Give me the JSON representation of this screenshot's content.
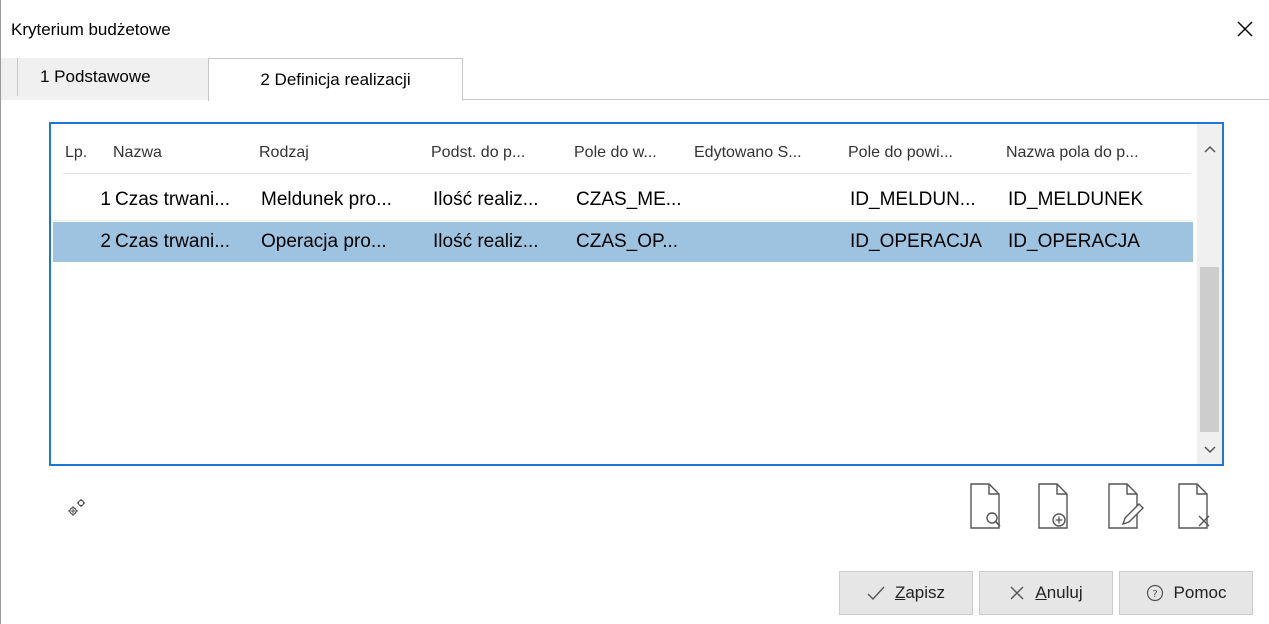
{
  "window": {
    "title": "Kryterium budżetowe"
  },
  "tabs": [
    {
      "label": "1 Podstawowe"
    },
    {
      "label": "2 Definicja realizacji"
    }
  ],
  "grid": {
    "columns": {
      "lp": "Lp.",
      "nazwa": "Nazwa",
      "rodzaj": "Rodzaj",
      "podst": "Podst. do p...",
      "pole": "Pole do w...",
      "edyt": "Edytowano S...",
      "powi": "Pole do powi...",
      "npola": "Nazwa pola do p..."
    },
    "rows": [
      {
        "lp": "1",
        "nazwa": "Czas trwani...",
        "rodzaj": "Meldunek pro...",
        "podst": "Ilość realiz...",
        "pole": "CZAS_ME...",
        "edyt": "",
        "powi": "ID_MELDUN...",
        "npola": "ID_MELDUNEK"
      },
      {
        "lp": "2",
        "nazwa": "Czas trwani...",
        "rodzaj": "Operacja pro...",
        "podst": "Ilość realiz...",
        "pole": "CZAS_OP...",
        "edyt": "",
        "powi": "ID_OPERACJA",
        "npola": "ID_OPERACJA"
      }
    ],
    "selected_row_color": "#9ec3e0"
  },
  "buttons": {
    "save": {
      "prefix": "",
      "underlined": "Z",
      "rest": "apisz"
    },
    "cancel": {
      "underlined": "A",
      "rest": "nuluj"
    },
    "help": {
      "label": "Pomoc"
    }
  },
  "icons": {
    "close": "close-icon",
    "gear": "gear-icon",
    "view": "document-preview-icon",
    "add": "document-add-icon",
    "edit": "document-edit-icon",
    "delete": "document-delete-icon"
  },
  "colors": {
    "focus_border": "#1e78d2",
    "button_bg": "#e6e6e6"
  }
}
